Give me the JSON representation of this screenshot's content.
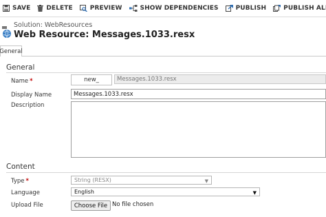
{
  "toolbar": {
    "save": "SAVE",
    "delete": "DELETE",
    "preview": "PREVIEW",
    "show_dependencies": "SHOW DEPENDENCIES",
    "publish": "PUBLISH",
    "publish_all": "PUBLISH ALL CUSTOMIZ..."
  },
  "header": {
    "solution": "Solution: WebResources",
    "title": "Web Resource: Messages.1033.resx"
  },
  "tabs": {
    "general": "General"
  },
  "general_section": {
    "title": "General",
    "name_label": "Name",
    "name_prefix": "new_",
    "name_value": "Messages.1033.resx",
    "display_name_label": "Display Name",
    "display_name_value": "Messages.1033.resx",
    "description_label": "Description",
    "description_value": ""
  },
  "content_section": {
    "title": "Content",
    "type_label": "Type",
    "type_value": "String (RESX)",
    "language_label": "Language",
    "language_value": "English",
    "upload_label": "Upload File",
    "choose_file": "Choose File",
    "no_file": "No file chosen"
  },
  "required_marker": "*",
  "colors": {
    "required": "#c00000",
    "accent_blue": "#2f6fb5"
  }
}
